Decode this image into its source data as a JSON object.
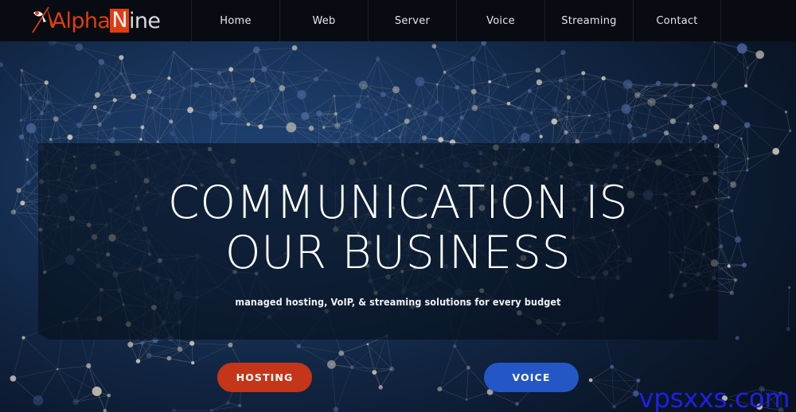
{
  "brand": {
    "logo_alpha": "Alpha",
    "logo_n": "N",
    "logo_ine": "ine",
    "logo_full": "AlphaNine",
    "accent_orange": "#e03c12",
    "accent_blue": "#2457c5"
  },
  "nav": {
    "items": [
      {
        "label": "Home"
      },
      {
        "label": "Web"
      },
      {
        "label": "Server"
      },
      {
        "label": "Voice"
      },
      {
        "label": "Streaming"
      },
      {
        "label": "Contact"
      }
    ]
  },
  "hero": {
    "title": "COMMUNICATION IS OUR BUSINESS",
    "subtitle": "managed hosting, VoIP, & streaming solutions for every budget",
    "buttons": [
      {
        "label": "HOSTING",
        "color": "#c4351a"
      },
      {
        "label": "VOICE",
        "color": "#2457c5"
      }
    ],
    "background": "world-map-network-graphic"
  },
  "watermark": {
    "text": "vpsxxs.com",
    "color": "#2020ee"
  }
}
